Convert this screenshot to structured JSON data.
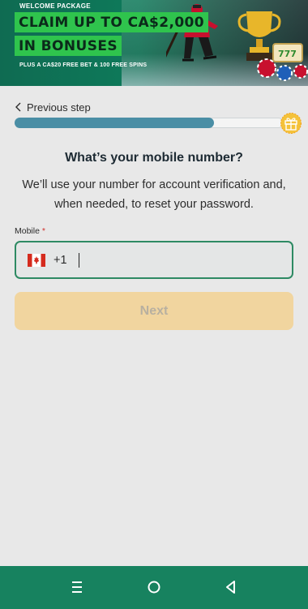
{
  "banner": {
    "eyebrow": "WELCOME PACKAGE",
    "headline_line1": "CLAIM UP TO CA$2,000",
    "headline_line2": "IN BONUSES",
    "subline": "PLUS A CA$20 FREE BET & 100 FREE SPINS",
    "accent_color": "#2fc44d"
  },
  "progress": {
    "previous_label": "Previous step",
    "fraction": 0.74,
    "bar_color": "#4a8ea5",
    "reward_icon": "gift-icon"
  },
  "question": {
    "title": "What’s your mobile number?",
    "description": "We’ll use your number for account verification and, when needed, to reset your password."
  },
  "phone_field": {
    "label": "Mobile",
    "required_mark": "*",
    "country_flag": "canada-flag-icon",
    "dial_code": "+1",
    "value": "",
    "border_color": "#2e8a63"
  },
  "next_button": {
    "label": "Next",
    "color": "#f1d59f"
  },
  "system_nav": {
    "color": "#17825f",
    "icons": [
      "menu-icon",
      "home-icon",
      "back-icon"
    ]
  }
}
